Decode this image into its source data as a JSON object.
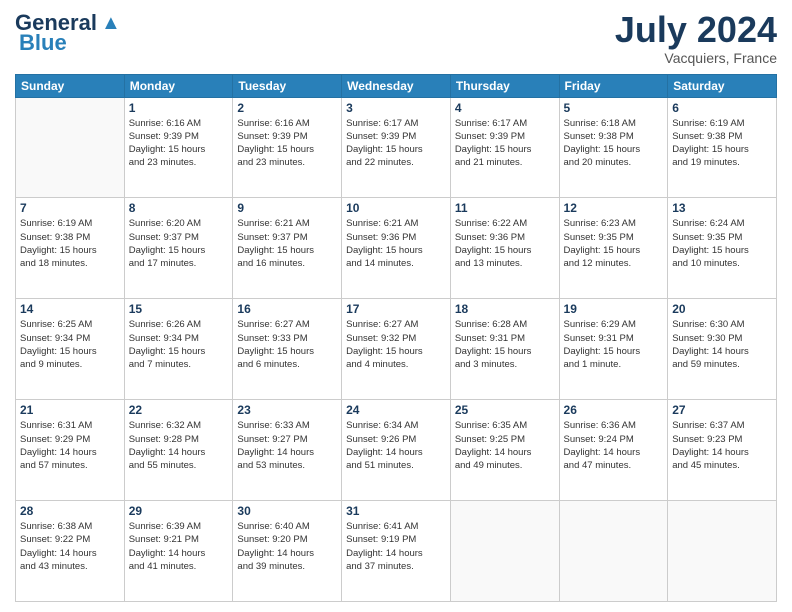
{
  "header": {
    "logo_line1": "General",
    "logo_line2": "Blue",
    "month_year": "July 2024",
    "location": "Vacquiers, France"
  },
  "days_of_week": [
    "Sunday",
    "Monday",
    "Tuesday",
    "Wednesday",
    "Thursday",
    "Friday",
    "Saturday"
  ],
  "weeks": [
    [
      {
        "day": "",
        "info": ""
      },
      {
        "day": "1",
        "info": "Sunrise: 6:16 AM\nSunset: 9:39 PM\nDaylight: 15 hours\nand 23 minutes."
      },
      {
        "day": "2",
        "info": "Sunrise: 6:16 AM\nSunset: 9:39 PM\nDaylight: 15 hours\nand 23 minutes."
      },
      {
        "day": "3",
        "info": "Sunrise: 6:17 AM\nSunset: 9:39 PM\nDaylight: 15 hours\nand 22 minutes."
      },
      {
        "day": "4",
        "info": "Sunrise: 6:17 AM\nSunset: 9:39 PM\nDaylight: 15 hours\nand 21 minutes."
      },
      {
        "day": "5",
        "info": "Sunrise: 6:18 AM\nSunset: 9:38 PM\nDaylight: 15 hours\nand 20 minutes."
      },
      {
        "day": "6",
        "info": "Sunrise: 6:19 AM\nSunset: 9:38 PM\nDaylight: 15 hours\nand 19 minutes."
      }
    ],
    [
      {
        "day": "7",
        "info": "Sunrise: 6:19 AM\nSunset: 9:38 PM\nDaylight: 15 hours\nand 18 minutes."
      },
      {
        "day": "8",
        "info": "Sunrise: 6:20 AM\nSunset: 9:37 PM\nDaylight: 15 hours\nand 17 minutes."
      },
      {
        "day": "9",
        "info": "Sunrise: 6:21 AM\nSunset: 9:37 PM\nDaylight: 15 hours\nand 16 minutes."
      },
      {
        "day": "10",
        "info": "Sunrise: 6:21 AM\nSunset: 9:36 PM\nDaylight: 15 hours\nand 14 minutes."
      },
      {
        "day": "11",
        "info": "Sunrise: 6:22 AM\nSunset: 9:36 PM\nDaylight: 15 hours\nand 13 minutes."
      },
      {
        "day": "12",
        "info": "Sunrise: 6:23 AM\nSunset: 9:35 PM\nDaylight: 15 hours\nand 12 minutes."
      },
      {
        "day": "13",
        "info": "Sunrise: 6:24 AM\nSunset: 9:35 PM\nDaylight: 15 hours\nand 10 minutes."
      }
    ],
    [
      {
        "day": "14",
        "info": "Sunrise: 6:25 AM\nSunset: 9:34 PM\nDaylight: 15 hours\nand 9 minutes."
      },
      {
        "day": "15",
        "info": "Sunrise: 6:26 AM\nSunset: 9:34 PM\nDaylight: 15 hours\nand 7 minutes."
      },
      {
        "day": "16",
        "info": "Sunrise: 6:27 AM\nSunset: 9:33 PM\nDaylight: 15 hours\nand 6 minutes."
      },
      {
        "day": "17",
        "info": "Sunrise: 6:27 AM\nSunset: 9:32 PM\nDaylight: 15 hours\nand 4 minutes."
      },
      {
        "day": "18",
        "info": "Sunrise: 6:28 AM\nSunset: 9:31 PM\nDaylight: 15 hours\nand 3 minutes."
      },
      {
        "day": "19",
        "info": "Sunrise: 6:29 AM\nSunset: 9:31 PM\nDaylight: 15 hours\nand 1 minute."
      },
      {
        "day": "20",
        "info": "Sunrise: 6:30 AM\nSunset: 9:30 PM\nDaylight: 14 hours\nand 59 minutes."
      }
    ],
    [
      {
        "day": "21",
        "info": "Sunrise: 6:31 AM\nSunset: 9:29 PM\nDaylight: 14 hours\nand 57 minutes."
      },
      {
        "day": "22",
        "info": "Sunrise: 6:32 AM\nSunset: 9:28 PM\nDaylight: 14 hours\nand 55 minutes."
      },
      {
        "day": "23",
        "info": "Sunrise: 6:33 AM\nSunset: 9:27 PM\nDaylight: 14 hours\nand 53 minutes."
      },
      {
        "day": "24",
        "info": "Sunrise: 6:34 AM\nSunset: 9:26 PM\nDaylight: 14 hours\nand 51 minutes."
      },
      {
        "day": "25",
        "info": "Sunrise: 6:35 AM\nSunset: 9:25 PM\nDaylight: 14 hours\nand 49 minutes."
      },
      {
        "day": "26",
        "info": "Sunrise: 6:36 AM\nSunset: 9:24 PM\nDaylight: 14 hours\nand 47 minutes."
      },
      {
        "day": "27",
        "info": "Sunrise: 6:37 AM\nSunset: 9:23 PM\nDaylight: 14 hours\nand 45 minutes."
      }
    ],
    [
      {
        "day": "28",
        "info": "Sunrise: 6:38 AM\nSunset: 9:22 PM\nDaylight: 14 hours\nand 43 minutes."
      },
      {
        "day": "29",
        "info": "Sunrise: 6:39 AM\nSunset: 9:21 PM\nDaylight: 14 hours\nand 41 minutes."
      },
      {
        "day": "30",
        "info": "Sunrise: 6:40 AM\nSunset: 9:20 PM\nDaylight: 14 hours\nand 39 minutes."
      },
      {
        "day": "31",
        "info": "Sunrise: 6:41 AM\nSunset: 9:19 PM\nDaylight: 14 hours\nand 37 minutes."
      },
      {
        "day": "",
        "info": ""
      },
      {
        "day": "",
        "info": ""
      },
      {
        "day": "",
        "info": ""
      }
    ]
  ]
}
